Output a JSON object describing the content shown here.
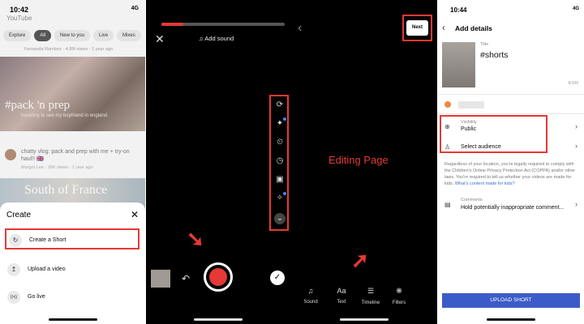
{
  "panel1": {
    "status_time": "10:42",
    "status_right": "4G",
    "app_header": "YouTube",
    "chips": [
      "Explore",
      "All",
      "New to you",
      "Live",
      "Mixes"
    ],
    "video1_meta": "Fernanda Ramírez · 4.8M views · 1 year ago",
    "thumb_caption": "#pack 'n prep",
    "thumb_subcaption": "traveling to see my boyfriend in england",
    "video2_title": "chatty vlog: pack and prep with me + try-on haul!! 🇬🇧",
    "video2_meta": "Margot Lee · 28K views · 1 year ago",
    "thumb2_caption": "South of France",
    "sheet_title": "Create",
    "sheet_close": "✕",
    "menu": [
      {
        "icon": "↻",
        "label": "Create a Short"
      },
      {
        "icon": "↥",
        "label": "Upload a video"
      },
      {
        "icon": "((•))",
        "label": "Go live"
      }
    ]
  },
  "panel2": {
    "progress": 0.18,
    "close": "✕",
    "add_sound": "♫  Add sound",
    "tools": [
      "⟳",
      "✦",
      "⏲",
      "◷",
      "▣",
      "✧",
      "⌄"
    ],
    "undo": "↶",
    "check": "✓"
  },
  "panel3": {
    "back": "‹",
    "next_label": "Next",
    "editing_label": "Editing Page",
    "tools": [
      {
        "glyph": "♫",
        "label": "Sound"
      },
      {
        "glyph": "Aa",
        "label": "Text"
      },
      {
        "glyph": "☰",
        "label": "Timeline"
      },
      {
        "glyph": "❋",
        "label": "Filters"
      }
    ]
  },
  "panel4": {
    "status_time": "10:44",
    "status_right": "4G",
    "back": "‹",
    "header": "Add details",
    "title_label": "Title",
    "title_value": "#shorts",
    "title_count": "8/100",
    "visibility_label": "Visibility",
    "visibility_value": "Public",
    "audience_label": "Select audience",
    "notice_text": "Regardless of your location, you're legally required to comply with the Children's Online Privacy Protection Act (COPPA) and/or other laws. You're required to tell us whether your videos are made for kids.",
    "notice_link": "What's content made for kids?",
    "comments_label": "Comments",
    "comments_value": "Hold potentially inappropriate comment...",
    "upload_label": "UPLOAD SHORT"
  },
  "colors": {
    "highlight": "#e53935",
    "record": "#e53935",
    "upload_button": "#3b5cc8"
  }
}
